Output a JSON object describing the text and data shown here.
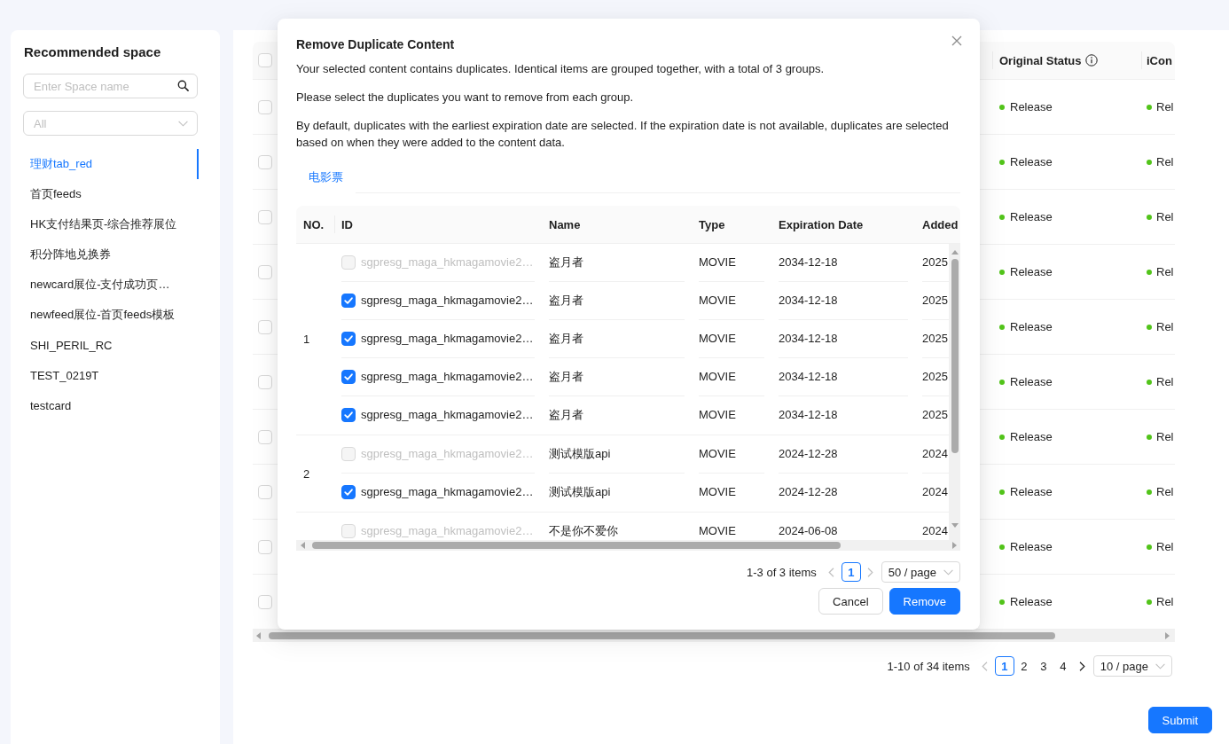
{
  "sidebar": {
    "title": "Recommended space",
    "search": {
      "placeholder": "Enter Space name"
    },
    "filter": {
      "placeholder": "All"
    },
    "items": [
      {
        "label": "理财tab_red",
        "selected": true
      },
      {
        "label": "首页feeds",
        "selected": false
      },
      {
        "label": "HK支付结果页-综合推荐展位",
        "selected": false
      },
      {
        "label": "积分阵地兑换券",
        "selected": false
      },
      {
        "label": "newcard展位-支付成功页…",
        "selected": false
      },
      {
        "label": "newfeed展位-首页feeds模板",
        "selected": false
      },
      {
        "label": "SHI_PERIL_RC",
        "selected": false
      },
      {
        "label": "TEST_0219T",
        "selected": false
      },
      {
        "label": "testcard",
        "selected": false
      }
    ]
  },
  "content_table": {
    "header_checked": false,
    "columns": [
      {
        "label": "Original Status",
        "info": true
      },
      {
        "label": "iCon"
      }
    ],
    "rows": [
      {
        "checked": false,
        "cells": [
          "Release",
          "Rel"
        ]
      },
      {
        "checked": false,
        "cells": [
          "Release",
          "Rel"
        ]
      },
      {
        "checked": false,
        "cells": [
          "Release",
          "Rel"
        ]
      },
      {
        "checked": false,
        "cells": [
          "Release",
          "Rel"
        ]
      },
      {
        "checked": false,
        "cells": [
          "Release",
          "Rel"
        ]
      },
      {
        "checked": false,
        "cells": [
          "Release",
          "Rel"
        ]
      },
      {
        "checked": false,
        "cells": [
          "Release",
          "Rel"
        ]
      },
      {
        "checked": false,
        "cells": [
          "Release",
          "Rel"
        ]
      },
      {
        "checked": false,
        "cells": [
          "Release",
          "Rel"
        ]
      },
      {
        "checked": false,
        "cells": [
          "Release",
          "Rel"
        ]
      }
    ]
  },
  "pagination": {
    "summary": "1-10 of 34 items",
    "prev_disabled": true,
    "next_disabled": false,
    "pages": [
      {
        "label": "1",
        "selected": true
      },
      {
        "label": "2",
        "selected": false
      },
      {
        "label": "3",
        "selected": false
      },
      {
        "label": "4",
        "selected": false
      }
    ],
    "page_size": "10 / page"
  },
  "submit": {
    "label": "Submit"
  },
  "modal": {
    "title": "Remove Duplicate Content",
    "paragraphs": [
      "Your selected content contains duplicates. Identical items are grouped together, with a total of 3 groups.",
      "Please select the duplicates you want to remove from each group.",
      "By default, duplicates with the earliest expiration date are selected. If the expiration date is not available, duplicates are selected based on when they were added to the content data."
    ],
    "tabs": [
      {
        "label": "电影票",
        "selected": true
      }
    ],
    "table": {
      "columns": [
        "NO.",
        "ID",
        "Name",
        "Type",
        "Expiration Date",
        "Added"
      ],
      "groups": [
        {
          "no": "1",
          "rows": [
            {
              "checked": false,
              "disabled": true,
              "id": "sgpresg_maga_hkmagamovie2…",
              "name": "盗月者",
              "type": "MOVIE",
              "expiration_date": "2034-12-18",
              "added": "2025"
            },
            {
              "checked": true,
              "disabled": false,
              "id": "sgpresg_maga_hkmagamovie2…",
              "name": "盗月者",
              "type": "MOVIE",
              "expiration_date": "2034-12-18",
              "added": "2025"
            },
            {
              "checked": true,
              "disabled": false,
              "id": "sgpresg_maga_hkmagamovie2…",
              "name": "盗月者",
              "type": "MOVIE",
              "expiration_date": "2034-12-18",
              "added": "2025"
            },
            {
              "checked": true,
              "disabled": false,
              "id": "sgpresg_maga_hkmagamovie2…",
              "name": "盗月者",
              "type": "MOVIE",
              "expiration_date": "2034-12-18",
              "added": "2025"
            },
            {
              "checked": true,
              "disabled": false,
              "id": "sgpresg_maga_hkmagamovie2…",
              "name": "盗月者",
              "type": "MOVIE",
              "expiration_date": "2034-12-18",
              "added": "2025"
            }
          ]
        },
        {
          "no": "2",
          "rows": [
            {
              "checked": false,
              "disabled": true,
              "id": "sgpresg_maga_hkmagamovie2…",
              "name": "测试模版api",
              "type": "MOVIE",
              "expiration_date": "2024-12-28",
              "added": "2024"
            },
            {
              "checked": true,
              "disabled": false,
              "id": "sgpresg_maga_hkmagamovie2…",
              "name": "测试模版api",
              "type": "MOVIE",
              "expiration_date": "2024-12-28",
              "added": "2024"
            }
          ]
        },
        {
          "rows": [
            {
              "checked": false,
              "disabled": true,
              "id": "sgpresg_maga_hkmagamovie2…",
              "name": "不是你不爱你",
              "type": "MOVIE",
              "expiration_date": "2024-06-08",
              "added": "2024"
            }
          ]
        }
      ]
    },
    "pagination": {
      "summary": "1-3 of 3 items",
      "prev_disabled": true,
      "next_disabled": true,
      "pages": [
        {
          "label": "1",
          "selected": true
        }
      ],
      "page_size": "50 / page"
    },
    "buttons": [
      {
        "label": "Cancel",
        "kind": "default"
      },
      {
        "label": "Remove",
        "kind": "primary"
      }
    ]
  }
}
